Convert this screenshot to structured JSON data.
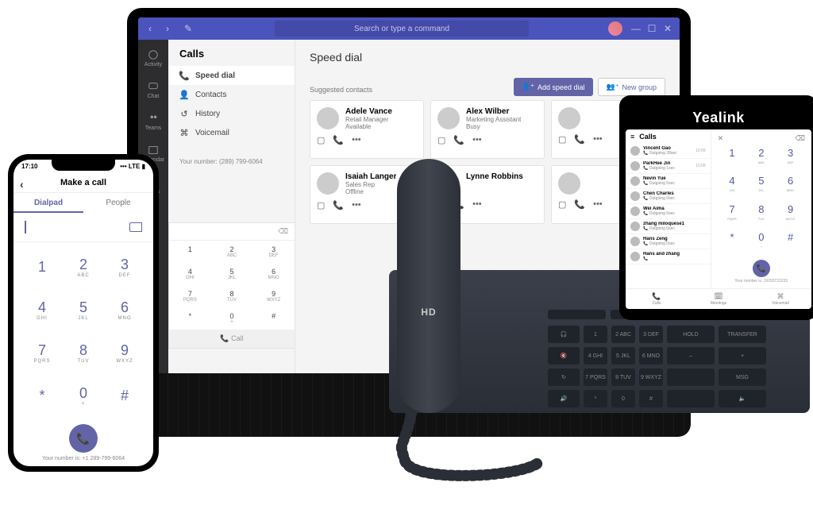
{
  "laptop": {
    "search_placeholder": "Search or type a command",
    "rail": [
      {
        "label": "Activity"
      },
      {
        "label": "Chat"
      },
      {
        "label": "Teams"
      },
      {
        "label": "Calendar"
      },
      {
        "label": "Calls"
      },
      {
        "label": "..."
      }
    ],
    "calls_panel": {
      "title": "Calls",
      "items": [
        "Speed dial",
        "Contacts",
        "History",
        "Voicemail"
      ],
      "your_number": "Your number: (289) 799-6064"
    },
    "main": {
      "title": "Speed dial",
      "add_speed_dial": "Add speed dial",
      "new_group": "New group",
      "suggested_label": "Suggested contacts",
      "contacts": [
        {
          "name": "Adele Vance",
          "role": "Retail Manager",
          "status": "Available"
        },
        {
          "name": "Alex Wilber",
          "role": "Marketing Assistant",
          "status": "Busy"
        },
        {
          "name": "",
          "role": "",
          "status": ""
        },
        {
          "name": "Isaiah Langer",
          "role": "Sales Rep",
          "status": "Offline"
        },
        {
          "name": "Lynne Robbins",
          "role": "",
          "status": ""
        },
        {
          "name": "",
          "role": "",
          "status": ""
        }
      ]
    },
    "dialpad": {
      "keys": [
        {
          "n": "1",
          "l": ""
        },
        {
          "n": "2",
          "l": "ABC"
        },
        {
          "n": "3",
          "l": "DEF"
        },
        {
          "n": "4",
          "l": "GHI"
        },
        {
          "n": "5",
          "l": "JKL"
        },
        {
          "n": "6",
          "l": "MNO"
        },
        {
          "n": "7",
          "l": "PQRS"
        },
        {
          "n": "8",
          "l": "TUV"
        },
        {
          "n": "9",
          "l": "WXYZ"
        },
        {
          "n": "*",
          "l": ""
        },
        {
          "n": "0",
          "l": "+"
        },
        {
          "n": "#",
          "l": ""
        }
      ],
      "call_label": "Call"
    }
  },
  "phone": {
    "time": "17:10",
    "signal": "LTE",
    "title": "Make a call",
    "tabs": [
      "Dialpad",
      "People"
    ],
    "keys": [
      {
        "n": "1",
        "l": ""
      },
      {
        "n": "2",
        "l": "ABC"
      },
      {
        "n": "3",
        "l": "DEF"
      },
      {
        "n": "4",
        "l": "GHI"
      },
      {
        "n": "5",
        "l": "JKL"
      },
      {
        "n": "6",
        "l": "MNO"
      },
      {
        "n": "7",
        "l": "PQRS"
      },
      {
        "n": "8",
        "l": "TUV"
      },
      {
        "n": "9",
        "l": "WXYZ"
      },
      {
        "n": "*",
        "l": ""
      },
      {
        "n": "0",
        "l": "+"
      },
      {
        "n": "#",
        "l": ""
      }
    ],
    "your_number": "Your number is: +1 289-799-6064"
  },
  "tablet": {
    "brand": "Yealink",
    "calls_title": "Calls",
    "recents": [
      {
        "name": "Vincent Gao",
        "sub": "Outgoing 28sec",
        "time": "10:09"
      },
      {
        "name": "ParkHee Jin",
        "sub": "Outgoing 1sec",
        "time": "10:08"
      },
      {
        "name": "Nevin Yue",
        "sub": "Outgoing 0sec",
        "time": ""
      },
      {
        "name": "Chen Charles",
        "sub": "Outgoing 0sec",
        "time": ""
      },
      {
        "name": "Wei Aima",
        "sub": "Outgoing 0sec",
        "time": ""
      },
      {
        "name": "zhang miloquese1",
        "sub": "Outgoing 0sec",
        "time": ""
      },
      {
        "name": "Hans Zeng",
        "sub": "Outgoing 0sec",
        "time": ""
      },
      {
        "name": "Hans and zhang",
        "sub": "",
        "time": ""
      }
    ],
    "keys": [
      {
        "n": "1",
        "l": ""
      },
      {
        "n": "2",
        "l": "ABC"
      },
      {
        "n": "3",
        "l": "DEF"
      },
      {
        "n": "4",
        "l": "GHI"
      },
      {
        "n": "5",
        "l": "JKL"
      },
      {
        "n": "6",
        "l": "MNO"
      },
      {
        "n": "7",
        "l": "PQRS"
      },
      {
        "n": "8",
        "l": "TUV"
      },
      {
        "n": "9",
        "l": "WXYZ"
      },
      {
        "n": "*",
        "l": ""
      },
      {
        "n": "0",
        "l": "+"
      },
      {
        "n": "#",
        "l": ""
      }
    ],
    "your_number": "Your number is: 19293723233",
    "footer": [
      "Calls",
      "Meetings",
      "Voicemail"
    ]
  },
  "deskphone": {
    "hd_label": "HD"
  }
}
